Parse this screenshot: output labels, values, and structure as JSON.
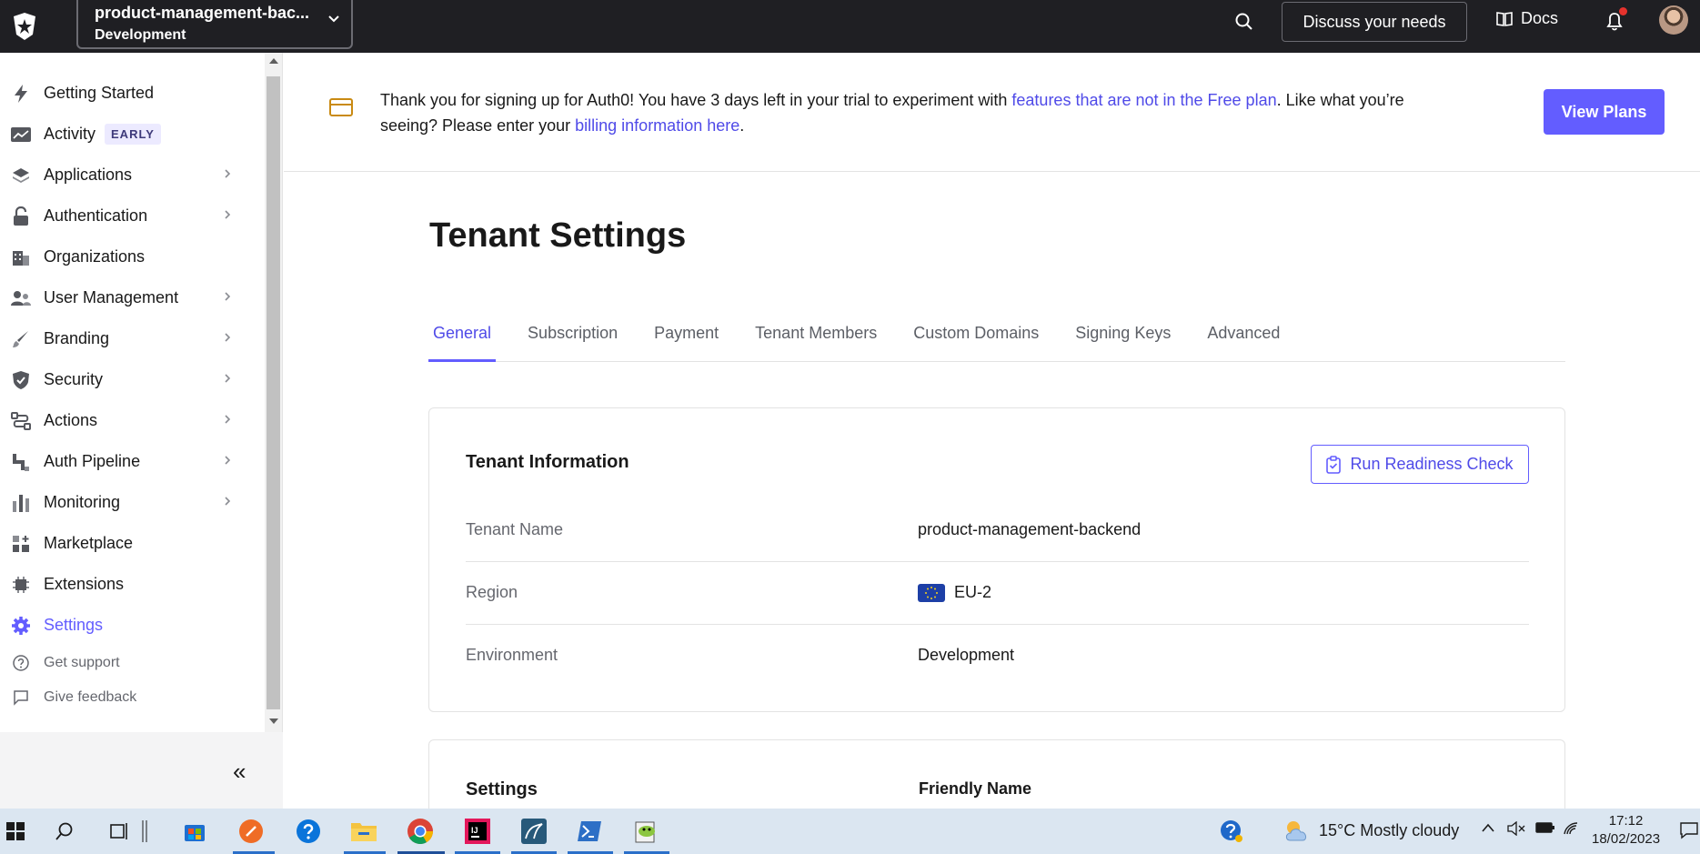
{
  "topbar": {
    "tenant_name": "product-management-bac...",
    "tenant_env": "Development",
    "discuss_label": "Discuss your needs",
    "docs_label": "Docs"
  },
  "sidebar": {
    "items": [
      {
        "label": "Getting Started",
        "icon": "bolt-icon"
      },
      {
        "label": "Activity",
        "icon": "chart-line-icon",
        "badge": "EARLY"
      },
      {
        "label": "Applications",
        "icon": "layers-icon"
      },
      {
        "label": "Authentication",
        "icon": "lock-icon"
      },
      {
        "label": "Organizations",
        "icon": "building-icon"
      },
      {
        "label": "User Management",
        "icon": "users-icon"
      },
      {
        "label": "Branding",
        "icon": "brush-icon"
      },
      {
        "label": "Security",
        "icon": "shield-icon"
      },
      {
        "label": "Actions",
        "icon": "flow-icon"
      },
      {
        "label": "Auth Pipeline",
        "icon": "pipeline-icon"
      },
      {
        "label": "Monitoring",
        "icon": "bar-chart-icon"
      },
      {
        "label": "Marketplace",
        "icon": "grid-plus-icon"
      },
      {
        "label": "Extensions",
        "icon": "chip-icon"
      },
      {
        "label": "Settings",
        "icon": "gear-icon"
      }
    ],
    "get_support": "Get support",
    "give_feedback": "Give feedback",
    "collapse_label": "«"
  },
  "banner": {
    "text_1": "Thank you for signing up for Auth0! You have 3 days left in your trial to experiment with ",
    "link_1": "features that are not in the Free plan",
    "text_2": ". Like what you’re seeing? Please enter your ",
    "link_2": "billing information here",
    "text_3": ".",
    "button": "View Plans"
  },
  "main": {
    "title": "Tenant Settings",
    "tabs": [
      "General",
      "Subscription",
      "Payment",
      "Tenant Members",
      "Custom Domains",
      "Signing Keys",
      "Advanced"
    ],
    "active_tab": "General",
    "card": {
      "title": "Tenant Information",
      "button": "Run Readiness Check",
      "rows": [
        {
          "label": "Tenant Name",
          "value": "product-management-backend"
        },
        {
          "label": "Region",
          "value": "EU-2"
        },
        {
          "label": "Environment",
          "value": "Development"
        }
      ]
    },
    "card2": {
      "title": "Settings",
      "field": "Friendly Name"
    }
  },
  "taskbar": {
    "weather": "15°C  Mostly cloudy",
    "time": "17:12",
    "date": "18/02/2023"
  },
  "colors": {
    "accent": "#635dff",
    "topbar": "#1f1f23",
    "link": "#4f4ae8"
  }
}
